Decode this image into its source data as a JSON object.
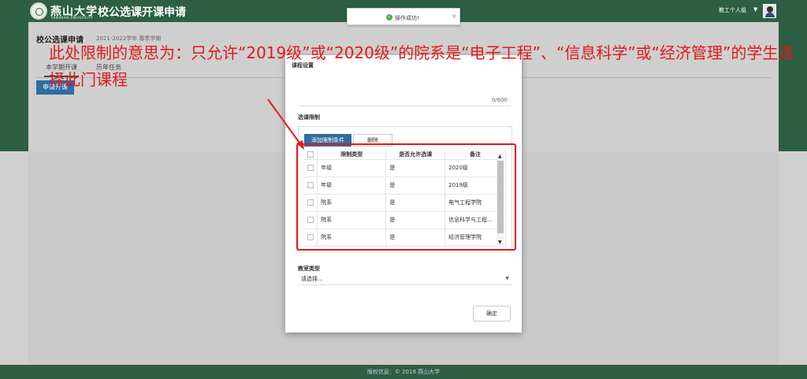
{
  "header": {
    "logo_cn": "燕山大学",
    "logo_en": "YANSHAN UNIVERSITY",
    "title": "校公选课开课申请",
    "user_label": "教工个人组"
  },
  "toast": {
    "text": "操作成功!",
    "close": "×"
  },
  "page": {
    "title": "校公选课申请",
    "term": "2021-2022学年 春季学期",
    "tabs": [
      "本学期开课",
      "历年任务"
    ],
    "apply_button": "申请开课"
  },
  "modal": {
    "course_settings_label": "课程设置",
    "char_count": "0/600",
    "restriction_label": "选课限制",
    "add_button": "添加限制条件",
    "delete_button": "删除",
    "table_headers": [
      "限制类型",
      "是否允许选课",
      "备注"
    ],
    "rows": [
      {
        "type": "年级",
        "allow": "是",
        "note": "2020级"
      },
      {
        "type": "年级",
        "allow": "是",
        "note": "2019级"
      },
      {
        "type": "院系",
        "allow": "是",
        "note": "电气工程学院"
      },
      {
        "type": "院系",
        "allow": "是",
        "note": "信息科学与工程..."
      },
      {
        "type": "院系",
        "allow": "是",
        "note": "经济管理学院"
      }
    ],
    "classroom_type_label": "教室类型",
    "classroom_select_placeholder": "请选择...",
    "confirm_button": "确定"
  },
  "annotation": {
    "text": "此处限制的意思为：只允许“2019级”或“2020级”的院系是“电子工程”、“信息科学”或“经济管理”的学生选择此门课程"
  },
  "footer": {
    "text": "版权信息：© 2018 燕山大学"
  },
  "colors": {
    "header_green": "#2c5f43",
    "primary_blue": "#2d6da3",
    "annotation_red": "#e31919"
  }
}
